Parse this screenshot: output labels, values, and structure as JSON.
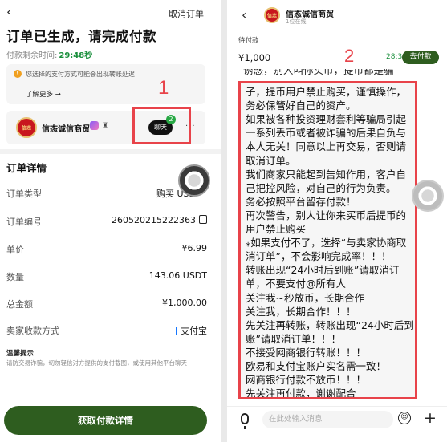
{
  "left": {
    "back_icon": "‹",
    "cancel_order": "取消订单",
    "title": "订单已生成，请完成付款",
    "timer_label": "付款剩余时间:",
    "timer_value": "29:48秒",
    "notice": {
      "icon": "!",
      "text": "您选择的支付方式可能会出现转账延迟",
      "more": "了解更多 →"
    },
    "merchant": {
      "avatar_text": "信志",
      "name": "信态诚信商贸",
      "badge_text": "♜"
    },
    "chat_button": "聊天",
    "chat_unread": "2",
    "more_dots": "···",
    "annotation_1": "1",
    "details_title": "订单详情",
    "rows": [
      {
        "label": "订单类型",
        "value": "购买 USD"
      },
      {
        "label": "订单编号",
        "value": "260520215222363"
      },
      {
        "label": "单价",
        "value": "¥6.99"
      },
      {
        "label": "数量",
        "value": "143.06 USDT"
      },
      {
        "label": "总金额",
        "value": "¥1,000.00"
      },
      {
        "label": "卖家收款方式",
        "value": "支付宝"
      }
    ],
    "tips_title": "温馨提示",
    "tips_text": "请防交易诈骗，切勿轻信对方提供的支付截图，或使用其他平台聊天",
    "primary_button": "获取付款详情"
  },
  "right": {
    "back_icon": "‹",
    "avatar_text": "信志",
    "merchant_name": "信态诚信商贸",
    "merchant_sub": "1位在线",
    "status": "待付款",
    "amount": "¥1,000",
    "time": "28:39",
    "pay_button": "去付款",
    "annotation_2": "2",
    "message_partial": "诱惑，别人叫你买币，提币都是骗",
    "message_lines": [
      "子，提币用户禁止购买，谨慎操作，",
      "务必保管好自己的资产。",
      "如果被各种投资理财套利等骗局引起",
      "一系列丢币或者被诈骗的后果自负与",
      "本人无关！同意以上再交易，否则请",
      "取消订单。",
      "我们商家只能起到告知作用，客户自",
      "己把控风险，对自己的行为负责。",
      "务必按照平台留存付款！",
      "再次警告，别人让你来买币后提币的",
      "用户禁止购买",
      "⁎如果支付不了，选择“与卖家协商取",
      "消订单”，不会影响完成率！！！",
      "转账出现“24小时后到账”请取消订",
      "单，不要支付@所有人",
      "关注我~秒放币，长期合作",
      "关注我，长期合作！！！",
      "先关注再转账，转账出现“24小时后到",
      "账”请取消订单！！！",
      "不接受网商银行转账！！！",
      "欧易和支付宝账户实名需一致！",
      "网商银行付款不放币！！！",
      "先关注再付款，谢谢配合"
    ],
    "input_placeholder": "在此处输入消息",
    "emoji_icon": "☺",
    "plus_icon": "+"
  }
}
